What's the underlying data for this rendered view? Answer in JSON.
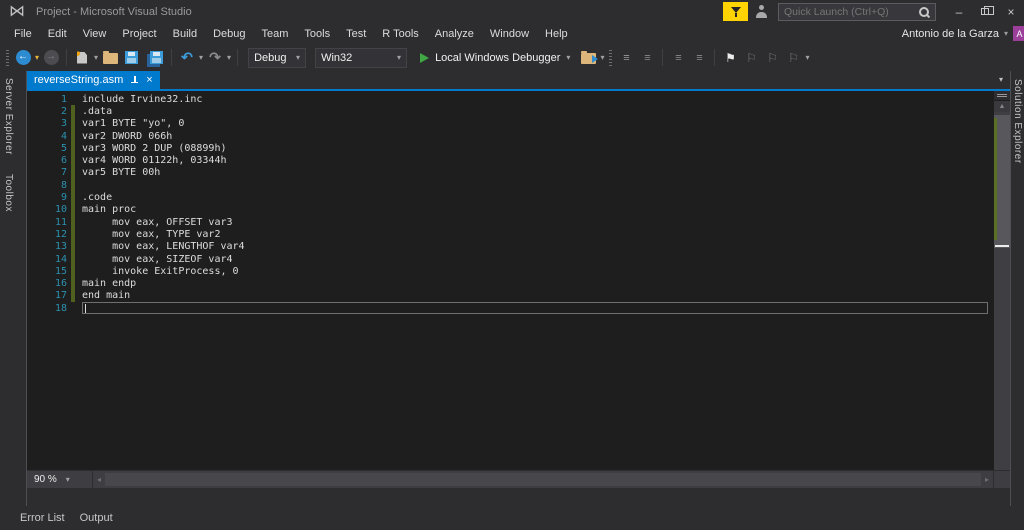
{
  "window": {
    "title": "Project - Microsoft Visual Studio",
    "quick_launch_placeholder": "Quick Launch (Ctrl+Q)",
    "user_name": "Antonio de la Garza",
    "avatar_initial": "A"
  },
  "menu": {
    "items": [
      "File",
      "Edit",
      "View",
      "Project",
      "Build",
      "Debug",
      "Team",
      "Tools",
      "Test",
      "R Tools",
      "Analyze",
      "Window",
      "Help"
    ]
  },
  "toolbar": {
    "configuration": "Debug",
    "platform": "Win32",
    "run_label": "Local Windows Debugger"
  },
  "editor": {
    "tab_label": "reverseString.asm",
    "zoom_level": "90 %",
    "lines": [
      {
        "n": 1,
        "text": "include Irvine32.inc",
        "modified": false,
        "current": false
      },
      {
        "n": 2,
        "text": ".data",
        "modified": true,
        "current": false
      },
      {
        "n": 3,
        "text": "var1 BYTE \"yo\", 0",
        "modified": true,
        "current": false
      },
      {
        "n": 4,
        "text": "var2 DWORD 066h",
        "modified": true,
        "current": false
      },
      {
        "n": 5,
        "text": "var3 WORD 2 DUP (08899h)",
        "modified": true,
        "current": false
      },
      {
        "n": 6,
        "text": "var4 WORD 01122h, 03344h",
        "modified": true,
        "current": false
      },
      {
        "n": 7,
        "text": "var5 BYTE 00h",
        "modified": true,
        "current": false
      },
      {
        "n": 8,
        "text": "",
        "modified": true,
        "current": false
      },
      {
        "n": 9,
        "text": ".code",
        "modified": true,
        "current": false
      },
      {
        "n": 10,
        "text": "main proc",
        "modified": true,
        "current": false
      },
      {
        "n": 11,
        "text": "     mov eax, OFFSET var3",
        "modified": true,
        "current": false
      },
      {
        "n": 12,
        "text": "     mov eax, TYPE var2",
        "modified": true,
        "current": false
      },
      {
        "n": 13,
        "text": "     mov eax, LENGTHOF var4",
        "modified": true,
        "current": false
      },
      {
        "n": 14,
        "text": "     mov eax, SIZEOF var4",
        "modified": true,
        "current": false
      },
      {
        "n": 15,
        "text": "     invoke ExitProcess, 0",
        "modified": true,
        "current": false
      },
      {
        "n": 16,
        "text": "main endp",
        "modified": true,
        "current": false
      },
      {
        "n": 17,
        "text": "end main",
        "modified": true,
        "current": false
      },
      {
        "n": 18,
        "text": "",
        "modified": false,
        "current": true
      }
    ]
  },
  "side_tabs": {
    "left": [
      "Server Explorer",
      "Toolbox"
    ],
    "right": [
      "Solution Explorer"
    ]
  },
  "bottom_tabs": [
    "Error List",
    "Output"
  ],
  "icons": {
    "logo": "⋈",
    "back": "←",
    "forward": "→",
    "undo": "↶",
    "redo": "↷",
    "caret": "▾",
    "bookmark": "⚑",
    "bookmark_alt": "⚐",
    "lines": "≡",
    "minimize": "–",
    "close": "×",
    "scroll_up": "▲",
    "scroll_down": "▼",
    "scroll_left": "◂",
    "scroll_right": "▸"
  },
  "colors": {
    "accent_blue": "#007ACC",
    "notification_yellow": "#FFD400",
    "avatar_purple": "#9B3F9B",
    "run_green": "#3FA743",
    "modified_line_green": "#50601F",
    "line_number_blue": "#2B91AF",
    "editor_background": "#1E1E1E",
    "ide_background": "#2D2D30"
  }
}
